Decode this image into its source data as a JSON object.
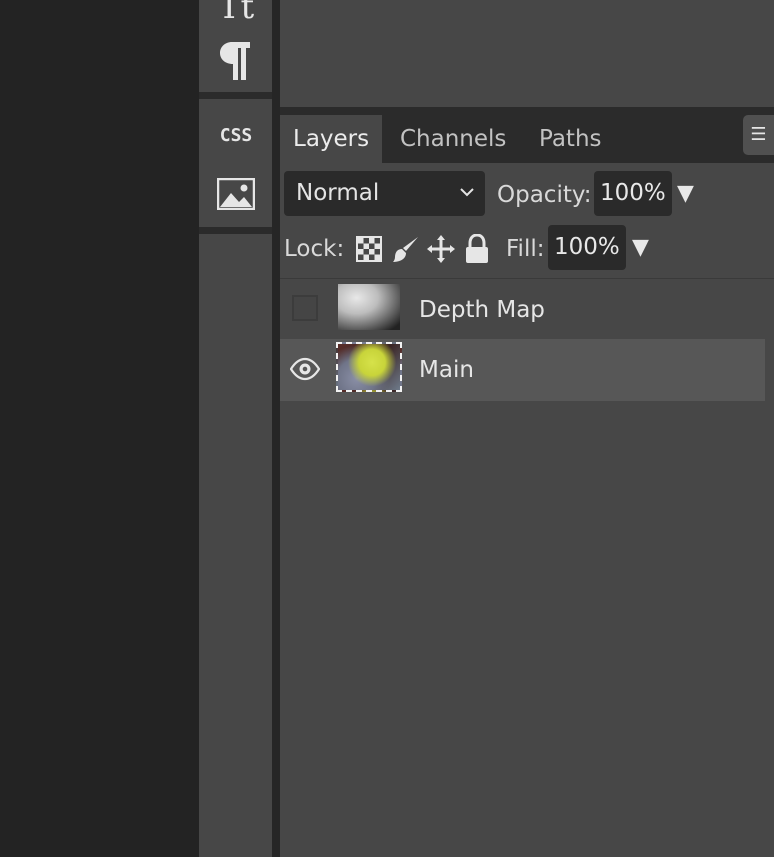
{
  "toolstrip": {
    "icons": [
      "text-vertical-icon",
      "paragraph-icon",
      "css-icon",
      "image-icon"
    ],
    "css_label": "CSS"
  },
  "panel": {
    "tabs": [
      {
        "label": "Layers",
        "active": true
      },
      {
        "label": "Channels",
        "active": false
      },
      {
        "label": "Paths",
        "active": false
      }
    ],
    "menu_icon": "hamburger-menu-icon"
  },
  "controls": {
    "blend_mode": "Normal",
    "opacity_label": "Opacity:",
    "opacity_value": "100%",
    "lock_label": "Lock:",
    "fill_label": "Fill:",
    "fill_value": "100%",
    "dropdown_arrow": "▼"
  },
  "layers": [
    {
      "name": "Depth Map",
      "visible": false,
      "selected": false
    },
    {
      "name": "Main",
      "visible": true,
      "selected": true
    }
  ],
  "colors": {
    "background": "#232323",
    "panel": "#474747",
    "tabbar": "#2b2b2b",
    "selected_row": "#575757"
  }
}
